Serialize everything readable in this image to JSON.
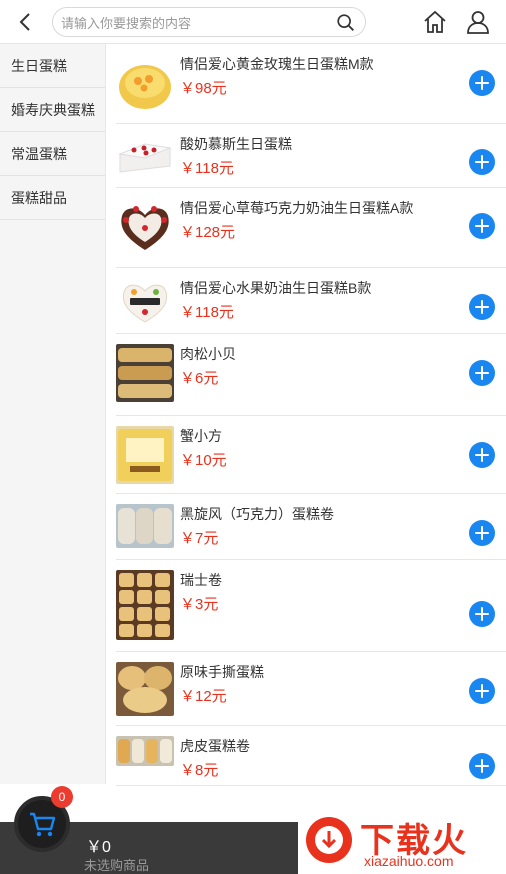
{
  "search": {
    "placeholder": "请输入你要搜索的内容"
  },
  "sidebar": {
    "items": [
      {
        "label": "生日蛋糕"
      },
      {
        "label": "婚寿庆典蛋糕"
      },
      {
        "label": "常温蛋糕"
      },
      {
        "label": "蛋糕甜品"
      }
    ]
  },
  "products": [
    {
      "name": "情侣爱心黄金玫瑰生日蛋糕M款",
      "price": "￥98元",
      "thumb": "cake-yellow"
    },
    {
      "name": "酸奶慕斯生日蛋糕",
      "price": "￥118元",
      "thumb": "cake-white"
    },
    {
      "name": "情侣爱心草莓巧克力奶油生日蛋糕A款",
      "price": "￥128元",
      "thumb": "cake-heart"
    },
    {
      "name": "情侣爱心水果奶油生日蛋糕B款",
      "price": "￥118元",
      "thumb": "cake-fruit"
    },
    {
      "name": "肉松小贝",
      "price": "￥6元",
      "thumb": "pastry"
    },
    {
      "name": "蟹小方",
      "price": "￥10元",
      "thumb": "pastry"
    },
    {
      "name": "黑旋风（巧克力）蛋糕卷",
      "price": "￥7元",
      "thumb": "roll"
    },
    {
      "name": "瑞士卷",
      "price": "￥3元",
      "thumb": "pastry"
    },
    {
      "name": "原味手撕蛋糕",
      "price": "￥12元",
      "thumb": "pastry"
    },
    {
      "name": "虎皮蛋糕卷",
      "price": "￥8元",
      "thumb": "roll"
    }
  ],
  "cart": {
    "count": "0",
    "total": "￥0",
    "hint": "未选购商品"
  },
  "watermark": {
    "text": "下载火",
    "url": "xiazaihuo.com"
  },
  "colors": {
    "price": "#e8321d",
    "add_button": "#1a86f0",
    "badge": "#ec3b2f"
  }
}
